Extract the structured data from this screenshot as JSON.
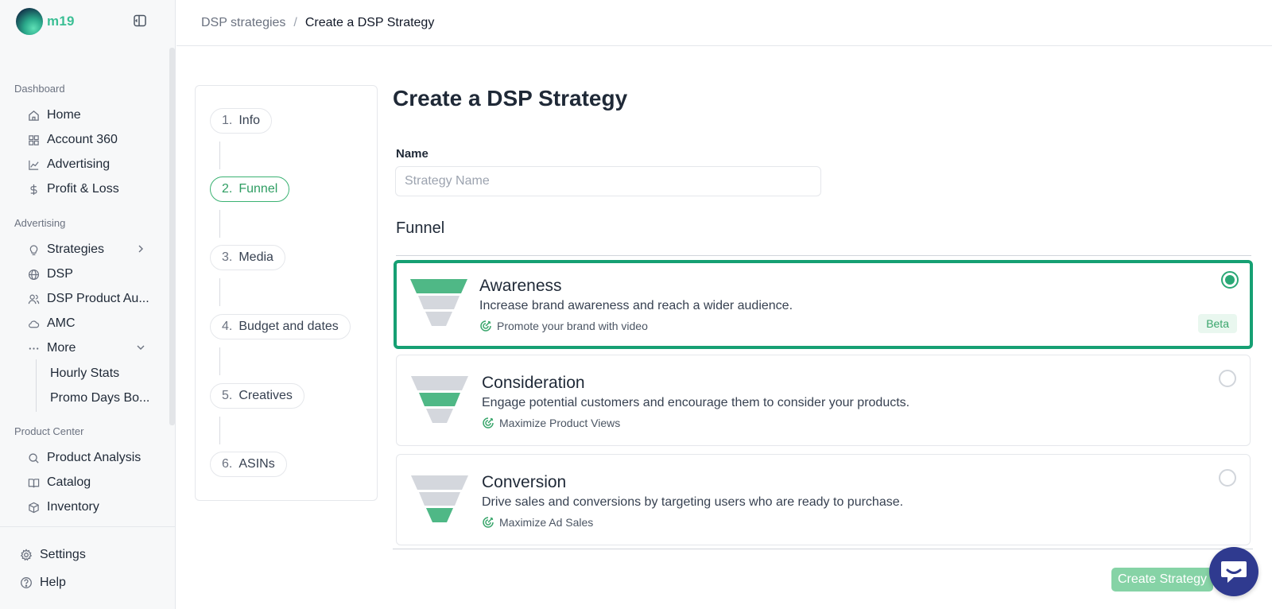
{
  "brand": {
    "name": "m19"
  },
  "breadcrumb": {
    "parent": "DSP strategies",
    "separator": "/",
    "current": "Create a DSP Strategy"
  },
  "sidebar": {
    "dashboard_section": "Dashboard",
    "dashboard_items": [
      {
        "label": "Home",
        "icon": "home-icon"
      },
      {
        "label": "Account 360",
        "icon": "grid-icon"
      },
      {
        "label": "Advertising",
        "icon": "line-chart-icon"
      },
      {
        "label": "Profit & Loss",
        "icon": "dollar-icon"
      }
    ],
    "advertising_section": "Advertising",
    "advertising_items": [
      {
        "label": "Strategies",
        "icon": "lightbulb-icon"
      },
      {
        "label": "DSP",
        "icon": "globe-icon"
      },
      {
        "label": "DSP Product Au...",
        "icon": "users-icon"
      },
      {
        "label": "AMC",
        "icon": "cloud-icon"
      },
      {
        "label": "More",
        "icon": "ellipsis-icon"
      }
    ],
    "more_subitems": [
      "Hourly Stats",
      "Promo Days Bo..."
    ],
    "product_section": "Product Center",
    "product_items": [
      {
        "label": "Product Analysis",
        "icon": "search-icon"
      },
      {
        "label": "Catalog",
        "icon": "book-icon"
      },
      {
        "label": "Inventory",
        "icon": "box-icon"
      }
    ],
    "footer_items": [
      {
        "label": "Settings",
        "icon": "gear-icon"
      },
      {
        "label": "Help",
        "icon": "help-icon"
      }
    ]
  },
  "stepper": {
    "steps": [
      {
        "num": "1.",
        "label": "Info"
      },
      {
        "num": "2.",
        "label": "Funnel"
      },
      {
        "num": "3.",
        "label": "Media"
      },
      {
        "num": "4.",
        "label": "Budget and dates"
      },
      {
        "num": "5.",
        "label": "Creatives"
      },
      {
        "num": "6.",
        "label": "ASINs"
      }
    ],
    "active": "Funnel"
  },
  "form": {
    "title": "Create a DSP Strategy",
    "name_label": "Name",
    "name_value": "",
    "name_placeholder": "Strategy Name",
    "funnel_label": "Funnel",
    "options": [
      {
        "title": "Awareness",
        "description": "Increase brand awareness and reach a wider audience.",
        "tag": "Promote your brand with video",
        "badge": "Beta",
        "selected": true
      },
      {
        "title": "Consideration",
        "description": "Engage potential customers and encourage them to consider your products.",
        "tag": "Maximize Product Views",
        "selected": false
      },
      {
        "title": "Conversion",
        "description": "Drive sales and conversions by targeting users who are ready to purchase.",
        "tag": "Maximize Ad Sales",
        "selected": false
      }
    ],
    "submit_label": "Create Strategy"
  },
  "colors": {
    "accent_green": "#16a073",
    "funnel_active": "#4fb886",
    "funnel_inactive": "#d4d7dd",
    "button_disabled": "#86d3a6",
    "chat_button": "#2f3a8f"
  }
}
